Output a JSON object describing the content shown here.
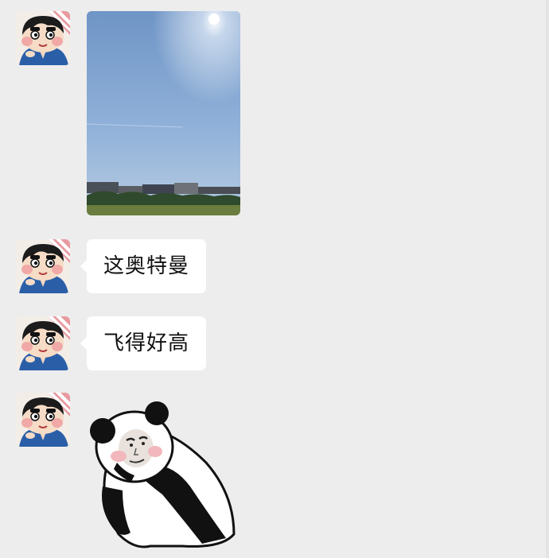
{
  "conversation": {
    "messages": [
      {
        "type": "image",
        "image_icon": "sky-photo",
        "avatar_icon": "cartoon-boy-avatar-icon"
      },
      {
        "type": "text",
        "text": "这奥特曼",
        "avatar_icon": "cartoon-boy-avatar-icon"
      },
      {
        "type": "text",
        "text": "飞得好高",
        "avatar_icon": "cartoon-boy-avatar-icon"
      },
      {
        "type": "sticker",
        "image_icon": "panda-meme-sticker",
        "avatar_icon": "cartoon-boy-avatar-icon"
      }
    ]
  },
  "colors": {
    "background": "#ededed",
    "bubble": "#ffffff",
    "text": "#111111"
  }
}
